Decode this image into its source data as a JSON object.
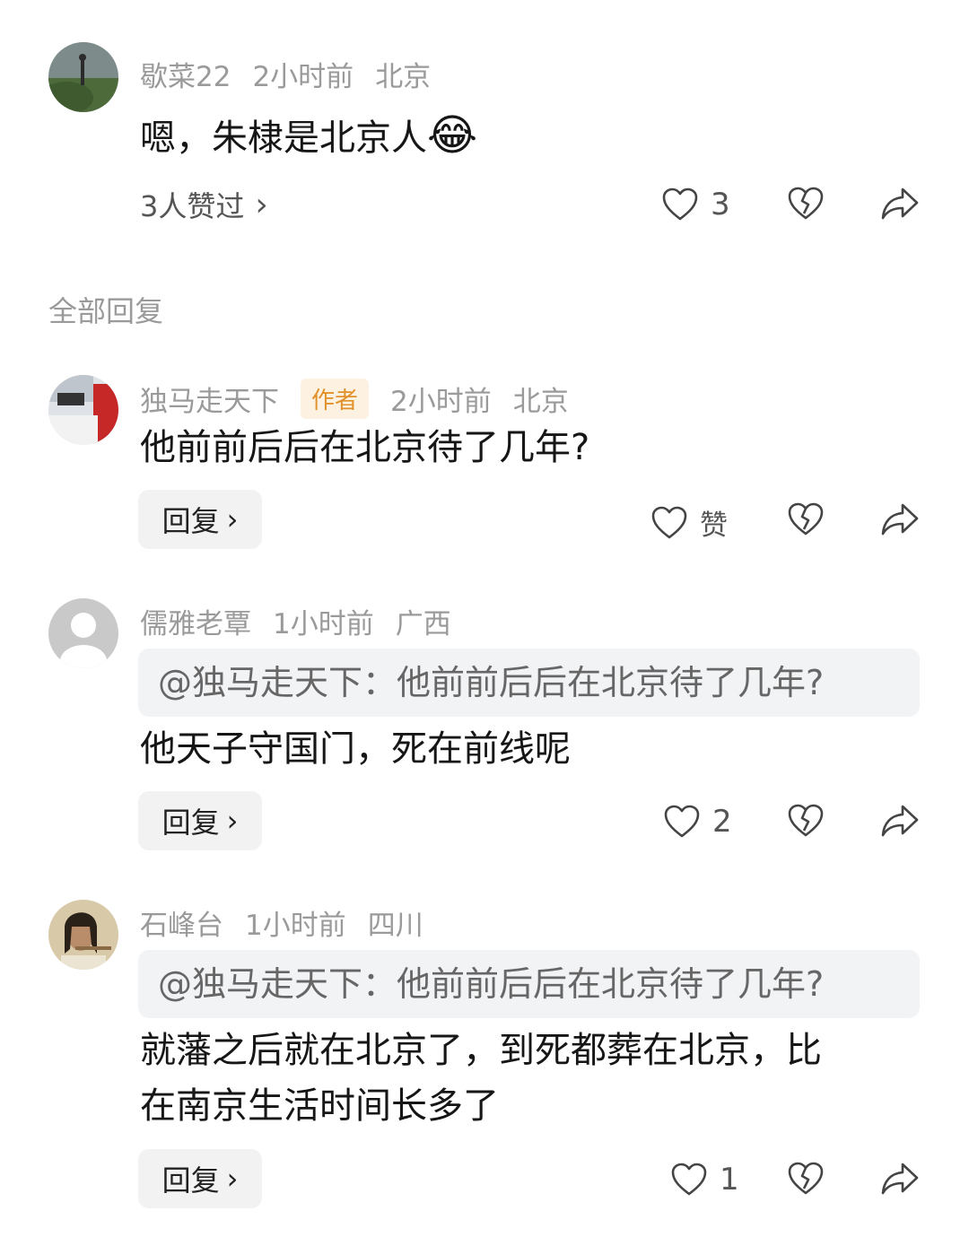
{
  "main_comment": {
    "username": "歇菜22",
    "time": "2小时前",
    "location": "北京",
    "text": "嗯，朱棣是北京人",
    "emoji": "😂",
    "likers_label": "3人赞过",
    "likers_chevron": "›",
    "like_count": "3"
  },
  "section_title": "全部回复",
  "replies": [
    {
      "username": "独马走天下",
      "badge": "作者",
      "time": "2小时前",
      "location": "北京",
      "text": "他前前后后在北京待了几年?",
      "reply_label": "回复",
      "like_label": "赞"
    },
    {
      "username": "儒雅老覃",
      "time": "1小时前",
      "location": "广西",
      "quote": "@独马走天下：他前前后后在北京待了几年?",
      "text": "他天子守国门，死在前线呢",
      "reply_label": "回复",
      "like_count": "2"
    },
    {
      "username": "石峰台",
      "time": "1小时前",
      "location": "四川",
      "quote": "@独马走天下：他前前后后在北京待了几年?",
      "text_line1": "就藩之后就在北京了，到死都葬在北京，比",
      "text_line2": "在南京生活时间长多了",
      "reply_label": "回复",
      "like_count": "1"
    }
  ],
  "chevron": "›",
  "icons": [
    "heart-icon",
    "broken-heart-icon",
    "share-icon",
    "emoji-laugh-icon"
  ],
  "colors": {
    "meta": "#9a9a9a",
    "author_badge_bg": "#fdf2e2",
    "author_badge_text": "#e0912a"
  }
}
